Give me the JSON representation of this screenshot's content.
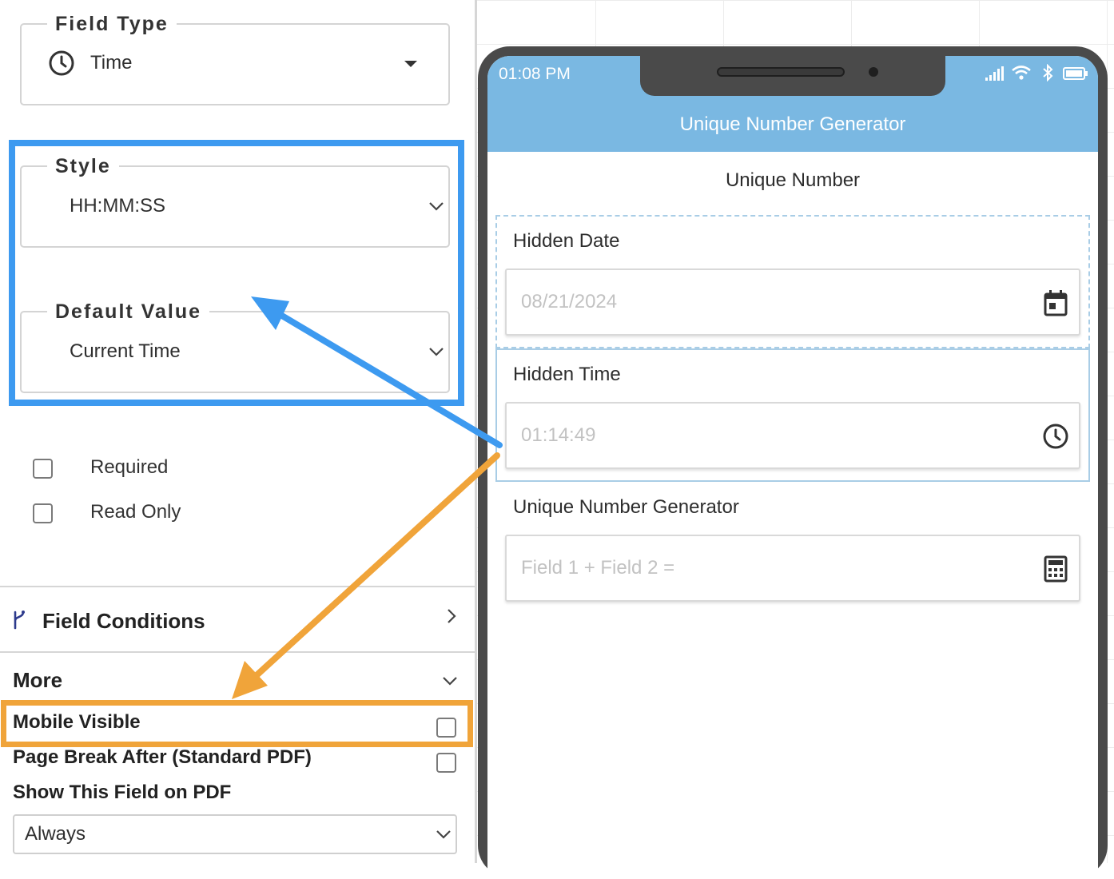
{
  "settings_panel": {
    "field_type": {
      "legend": "Field Type",
      "value": "Time",
      "icon": "clock-icon"
    },
    "style": {
      "legend": "Style",
      "value": "HH:MM:SS"
    },
    "default_value": {
      "legend": "Default Value",
      "value": "Current Time"
    },
    "checkboxes": [
      {
        "label": "Required",
        "checked": false
      },
      {
        "label": "Read Only",
        "checked": false
      }
    ],
    "field_conditions": {
      "title": "Field Conditions",
      "icon": "branch-icon"
    },
    "more": {
      "title": "More",
      "mobile_visible": {
        "label": "Mobile Visible",
        "checked": false
      },
      "page_break_after": {
        "label": "Page Break After (Standard PDF)",
        "checked": false
      },
      "show_on_pdf": {
        "label": "Show This Field on PDF",
        "value": "Always"
      }
    }
  },
  "phone_preview": {
    "status_bar": {
      "time": "01:08 PM"
    },
    "app_title": "Unique Number Generator",
    "form_title": "Unique Number",
    "fields": [
      {
        "label": "Hidden Date",
        "value": "08/21/2024",
        "icon": "calendar-icon"
      },
      {
        "label": "Hidden Time",
        "value": "01:14:49",
        "icon": "clock-icon"
      },
      {
        "label": "Unique Number Generator",
        "value": "Field 1 + Field 2 =",
        "icon": "calculator-icon"
      }
    ]
  },
  "annotations": {
    "blue_color": "#3d9af0",
    "orange_color": "#f0a43a"
  },
  "colors": {
    "app_bar": "#7ab8e2",
    "phone_frame": "#4a4a4a"
  }
}
